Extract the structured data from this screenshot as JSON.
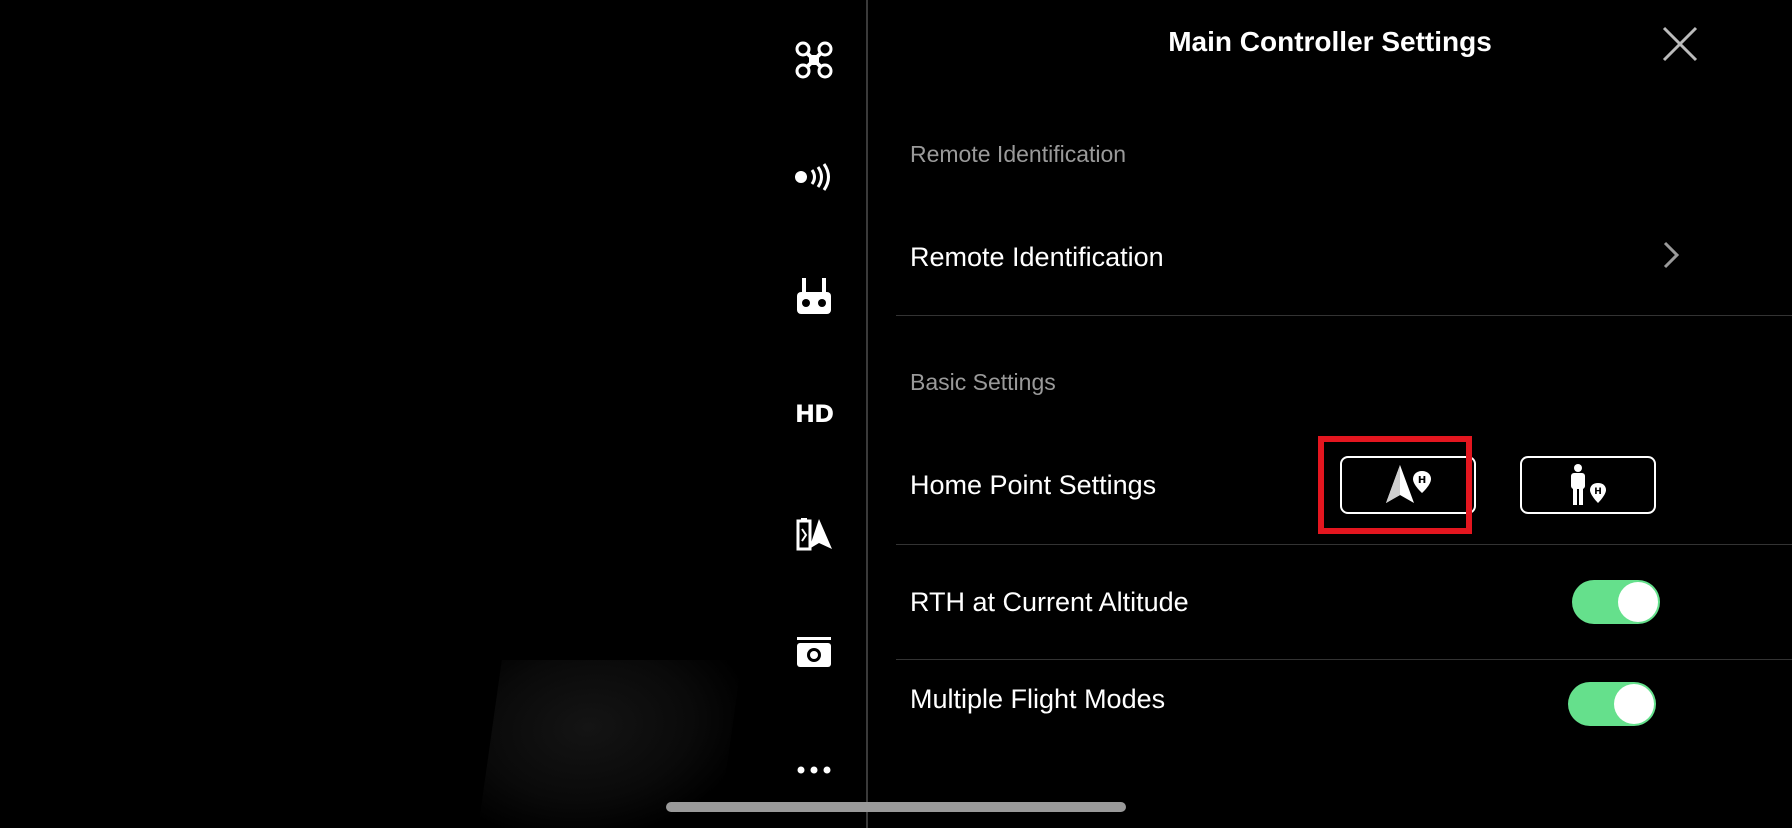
{
  "sidebar": {
    "icons": [
      {
        "name": "aircraft-icon"
      },
      {
        "name": "signal-icon"
      },
      {
        "name": "remote-controller-icon"
      },
      {
        "name": "hd-transmission-icon",
        "text": "HD"
      },
      {
        "name": "aircraft-battery-icon"
      },
      {
        "name": "camera-icon"
      },
      {
        "name": "more-icon"
      }
    ]
  },
  "panel": {
    "title": "Main Controller Settings",
    "close_icon": "close-icon",
    "sections": {
      "remote_id_header": "Remote Identification",
      "remote_id_row": "Remote Identification",
      "basic_header": "Basic Settings",
      "home_point_label": "Home Point Settings",
      "rth_label": "RTH at Current Altitude",
      "multi_flight_label": "Multiple Flight Modes"
    },
    "home_point_options": [
      {
        "icon": "aircraft-home-point-icon",
        "selected": true
      },
      {
        "icon": "pilot-home-point-icon",
        "selected": false
      }
    ],
    "toggles": {
      "rth_at_current_altitude": true,
      "multiple_flight_modes": true
    }
  },
  "colors": {
    "toggle_on": "#65e08c",
    "highlight": "#e4161f",
    "section_header": "#9a9a9a",
    "divider": "#333333"
  }
}
